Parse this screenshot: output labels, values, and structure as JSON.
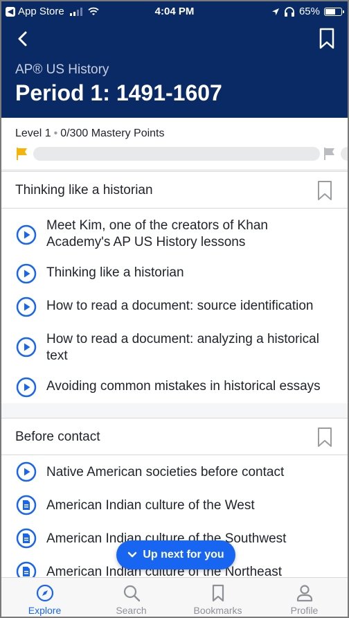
{
  "status_bar": {
    "back_app": "App Store",
    "time": "4:04 PM",
    "battery": "65%"
  },
  "header": {
    "course": "AP® US History",
    "title": "Period 1: 1491-1607"
  },
  "mastery": {
    "level": "Level 1",
    "points": "0/300 Mastery Points",
    "progress_fraction": 0
  },
  "sections": [
    {
      "title": "Thinking like a historian",
      "items": [
        {
          "label": "Meet Kim, one of the creators of Khan Academy's AP US History lessons",
          "type": "video"
        },
        {
          "label": "Thinking like a historian",
          "type": "video"
        },
        {
          "label": "How to read a document: source identification",
          "type": "video"
        },
        {
          "label": "How to read a document: analyzing a historical text",
          "type": "video"
        },
        {
          "label": "Avoiding common mistakes in historical essays",
          "type": "video"
        }
      ]
    },
    {
      "title": "Before contact",
      "items": [
        {
          "label": "Native American societies before contact",
          "type": "video"
        },
        {
          "label": "American Indian culture of the West",
          "type": "article"
        },
        {
          "label": "American Indian culture of the Southwest",
          "type": "article"
        },
        {
          "label": "American Indian culture of the Northeast",
          "type": "article"
        }
      ]
    }
  ],
  "up_next": {
    "label": "Up next for you"
  },
  "tabs": [
    {
      "label": "Explore",
      "icon": "compass-icon",
      "active": true
    },
    {
      "label": "Search",
      "icon": "search-icon",
      "active": false
    },
    {
      "label": "Bookmarks",
      "icon": "bookmark-icon",
      "active": false
    },
    {
      "label": "Profile",
      "icon": "profile-icon",
      "active": false
    }
  ],
  "colors": {
    "header_bg": "#0a2a66",
    "accent": "#1865f2",
    "flag": "#f5b40b"
  }
}
